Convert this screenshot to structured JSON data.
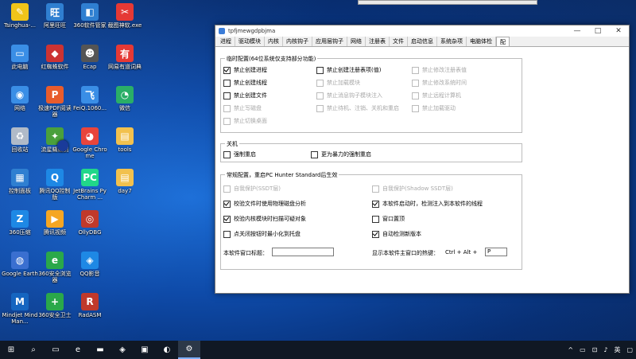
{
  "desktop_icons": [
    {
      "label": "Tsinghua-...",
      "glyph": "✎",
      "color": "#f0c419"
    },
    {
      "label": "此电脑",
      "glyph": "▭",
      "color": "#3a8ee6"
    },
    {
      "label": "网络",
      "glyph": "◉",
      "color": "#3a8ee6"
    },
    {
      "label": "回收站",
      "glyph": "♻",
      "color": "#b0bac8"
    },
    {
      "label": "控制面板",
      "glyph": "▦",
      "color": "#2f7fd1"
    },
    {
      "label": "360压缩",
      "glyph": "Z",
      "color": "#1e88e5"
    },
    {
      "label": "Google Earth",
      "glyph": "◍",
      "color": "#3a6fd0"
    },
    {
      "label": "Mindjet MindMan...",
      "glyph": "M",
      "color": "#1565c0"
    },
    {
      "label": "阿里旺旺",
      "glyph": "旺",
      "color": "#2f7fd1"
    },
    {
      "label": "红蜘蛛软件",
      "glyph": "◆",
      "color": "#cc3333"
    },
    {
      "label": "极速PDF阅读器",
      "glyph": "P",
      "color": "#e85c2c"
    },
    {
      "label": "流星蝴蝶剑",
      "glyph": "✦",
      "color": "#4aa03c"
    },
    {
      "label": "腾讯QQ控制版",
      "glyph": "Q",
      "color": "#1e88e5"
    },
    {
      "label": "腾讯视频",
      "glyph": "▶",
      "color": "#f5a623"
    },
    {
      "label": "360安全浏览器",
      "glyph": "e",
      "color": "#2aa84a"
    },
    {
      "label": "360安全卫士",
      "glyph": "+",
      "color": "#2aa84a"
    },
    {
      "label": "360软件管家",
      "glyph": "◧",
      "color": "#2f7fd1"
    },
    {
      "label": "Ecap",
      "glyph": "☻",
      "color": "#555"
    },
    {
      "label": "FeiQ.1060...",
      "glyph": "飞",
      "color": "#3a8ee6"
    },
    {
      "label": "Google Chrome",
      "glyph": "◕",
      "color": "#e8453c"
    },
    {
      "label": "JetBrains PyCharm ...",
      "glyph": "PC",
      "color": "#21d789"
    },
    {
      "label": "OllyDBG",
      "glyph": "◎",
      "color": "#c0392b"
    },
    {
      "label": "QQ影音",
      "glyph": "◈",
      "color": "#1e88e5"
    },
    {
      "label": "RadASM",
      "glyph": "R",
      "color": "#c0392b"
    },
    {
      "label": "截图神软.exe",
      "glyph": "✂",
      "color": "#e53935"
    },
    {
      "label": "网易有道词典",
      "glyph": "有",
      "color": "#e53935"
    },
    {
      "label": "微信",
      "glyph": "◔",
      "color": "#2aae67"
    },
    {
      "label": "tools",
      "glyph": "▤",
      "color": "#f2c14e"
    },
    {
      "label": "day7",
      "glyph": "▤",
      "color": "#f2c14e"
    }
  ],
  "window": {
    "title": "tpfjmewgdpbjma",
    "tabs": [
      "进程",
      "驱动模块",
      "内核",
      "内核钩子",
      "应用层钩子",
      "网络",
      "注册表",
      "文件",
      "启动信息",
      "系统杂项",
      "电脑体检",
      "配"
    ],
    "group1": {
      "title": "临时配置(64位系统仅支持部分功能)",
      "col1": [
        {
          "label": "禁止创建进程",
          "checked": true,
          "disabled": false
        },
        {
          "label": "禁止创建线程",
          "checked": false,
          "disabled": false
        },
        {
          "label": "禁止创建文件",
          "checked": false,
          "disabled": false
        },
        {
          "label": "禁止写磁盘",
          "checked": false,
          "disabled": true
        },
        {
          "label": "禁止切换桌面",
          "checked": false,
          "disabled": true
        }
      ],
      "col2": [
        {
          "label": "禁止创建注册表项(值)",
          "checked": false,
          "disabled": false
        },
        {
          "label": "禁止加载模块",
          "checked": false,
          "disabled": true
        },
        {
          "label": "禁止消息钩子模块注入",
          "checked": false,
          "disabled": true
        },
        {
          "label": "禁止待机、注销、关机和重启",
          "checked": false,
          "disabled": true
        }
      ],
      "col3": [
        {
          "label": "禁止修改注册表值",
          "checked": false,
          "disabled": true
        },
        {
          "label": "禁止修改系统时间",
          "checked": false,
          "disabled": true
        },
        {
          "label": "禁止远程计算机",
          "checked": false,
          "disabled": true
        },
        {
          "label": "禁止加载驱动",
          "checked": false,
          "disabled": true
        }
      ]
    },
    "group2": {
      "title": "关机",
      "items": [
        {
          "label": "强制重启",
          "checked": false,
          "disabled": false
        },
        {
          "label": "更为暴力的强制重启",
          "checked": false,
          "disabled": false
        }
      ]
    },
    "group3": {
      "title": "常规配置，重启PC Hunter Standard后生效",
      "left": [
        {
          "label": "自我保护(SSDT层)",
          "checked": false,
          "disabled": true
        },
        {
          "label": "校验文件时使用物理磁盘分析",
          "checked": true,
          "disabled": false
        },
        {
          "label": "校验内核模块时扫描可疑对象",
          "checked": true,
          "disabled": false
        },
        {
          "label": "点关闭按钮时最小化到托盘",
          "checked": false,
          "disabled": false
        }
      ],
      "right": [
        {
          "label": "自我保护(Shadow SSDT层)",
          "checked": false,
          "disabled": true
        },
        {
          "label": "本软件启动时，检测注入到本软件的线程",
          "checked": true,
          "disabled": false
        },
        {
          "label": "窗口置顶",
          "checked": false,
          "disabled": false
        },
        {
          "label": "自动检测新版本",
          "checked": true,
          "disabled": false
        }
      ],
      "title_label": "本软件窗口标题：",
      "title_value": "",
      "hotkey_label": "显示本软件主窗口的热键：",
      "hotkey_combo": "Ctrl + Alt +",
      "hotkey_value": "P"
    }
  },
  "taskbar": {
    "items": [
      {
        "glyph": "⊞",
        "name": "start"
      },
      {
        "glyph": "⌕",
        "name": "search"
      },
      {
        "glyph": "▭",
        "name": "task-view"
      },
      {
        "glyph": "e",
        "name": "edge"
      },
      {
        "glyph": "▬",
        "name": "explorer"
      },
      {
        "glyph": "◈",
        "name": "app1"
      },
      {
        "glyph": "▣",
        "name": "app2"
      },
      {
        "glyph": "◐",
        "name": "app3"
      },
      {
        "glyph": "⚙",
        "name": "pchunter"
      }
    ],
    "ime": "英",
    "tray_glyphs": [
      "^",
      "▭",
      "⊡",
      "♪"
    ]
  }
}
